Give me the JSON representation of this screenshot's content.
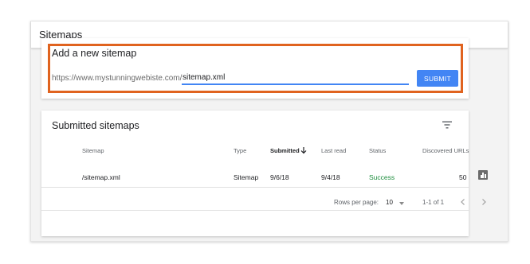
{
  "page": {
    "title": "Sitemaps"
  },
  "add_sitemap": {
    "title": "Add a new sitemap",
    "url_prefix": "https://www.mystunningwebiste.com/",
    "input_value": "sitemap.xml",
    "submit_label": "SUBMIT"
  },
  "submitted": {
    "title": "Submitted sitemaps",
    "columns": {
      "sitemap": "Sitemap",
      "type": "Type",
      "submitted": "Submitted",
      "last_read": "Last read",
      "status": "Status",
      "discovered": "Discovered URLs"
    },
    "rows": [
      {
        "sitemap": "/sitemap.xml",
        "type": "Sitemap",
        "submitted": "9/6/18",
        "last_read": "9/4/18",
        "status": "Success",
        "discovered": "50"
      }
    ],
    "pagination": {
      "rows_per_page_label": "Rows per page:",
      "rows_per_page": "10",
      "range": "1-1 of 1"
    }
  },
  "colors": {
    "accent": "#4285f4",
    "highlight": "#e0631f",
    "success": "#1e8e3e"
  },
  "icons": [
    "filter-icon",
    "sort-down-icon",
    "bar-chart-icon",
    "dropdown-arrow-icon",
    "chevron-left-icon",
    "chevron-right-icon"
  ]
}
